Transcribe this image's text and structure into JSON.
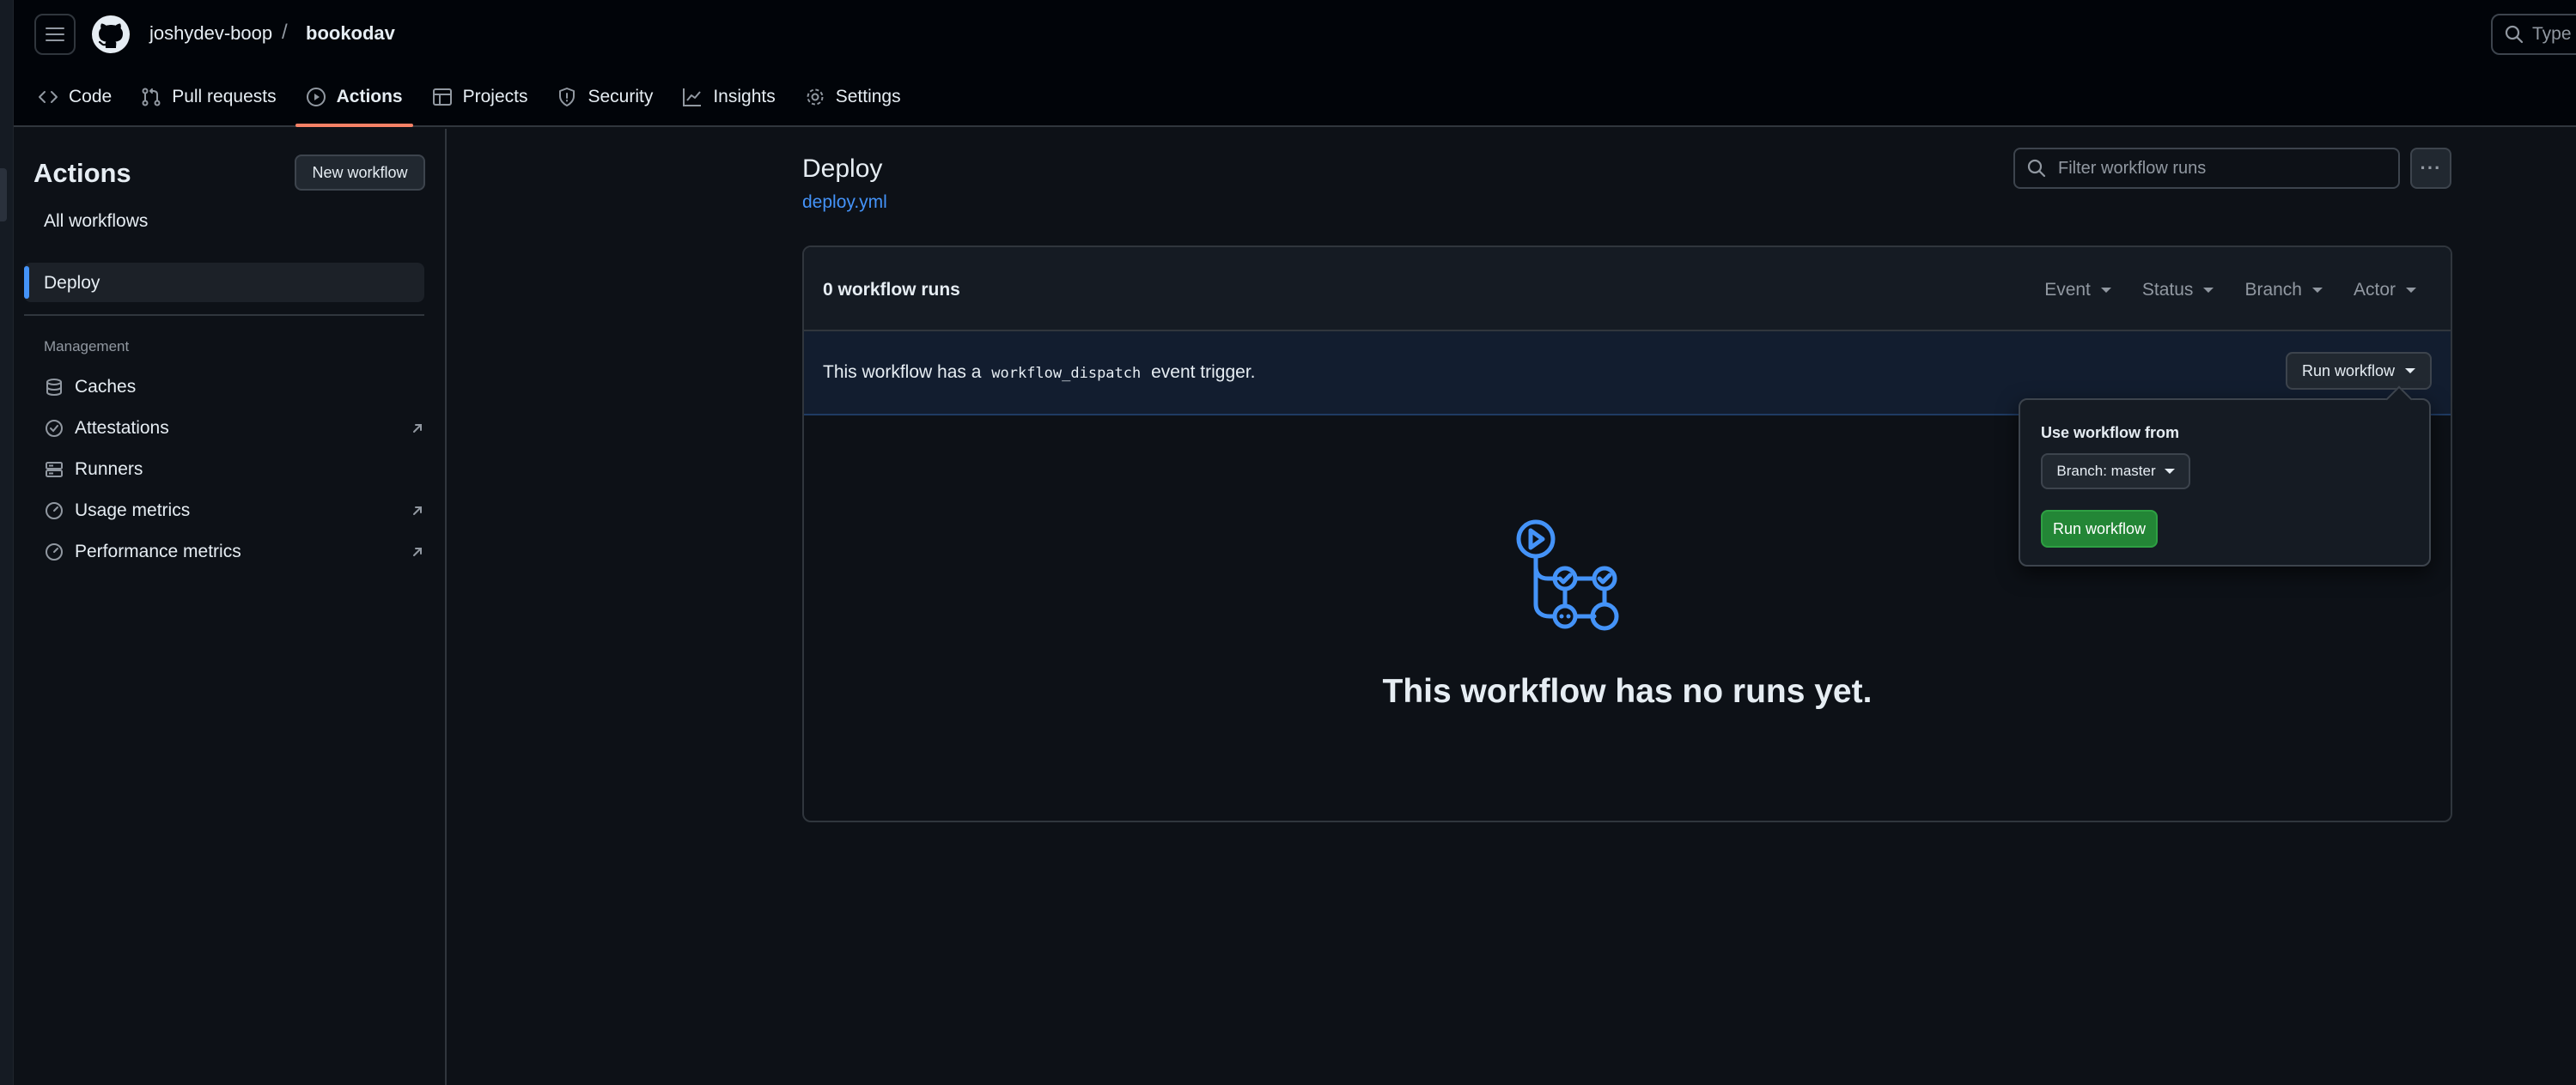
{
  "header": {
    "owner": "joshydev-boop",
    "separator": "/",
    "repo": "bookodav",
    "search_text": "Type",
    "tabs": [
      {
        "label": "Code",
        "icon": "code-icon"
      },
      {
        "label": "Pull requests",
        "icon": "pull-request-icon"
      },
      {
        "label": "Actions",
        "icon": "play-icon",
        "active": true
      },
      {
        "label": "Projects",
        "icon": "table-icon"
      },
      {
        "label": "Security",
        "icon": "shield-icon"
      },
      {
        "label": "Insights",
        "icon": "graph-icon"
      },
      {
        "label": "Settings",
        "icon": "gear-icon"
      }
    ]
  },
  "sidebar": {
    "title": "Actions",
    "new_workflow_label": "New workflow",
    "all_workflows_label": "All workflows",
    "active_workflow": "Deploy",
    "management_heading": "Management",
    "management_items": [
      {
        "label": "Caches",
        "icon": "database-icon",
        "external": false
      },
      {
        "label": "Attestations",
        "icon": "verified-icon",
        "external": true
      },
      {
        "label": "Runners",
        "icon": "server-icon",
        "external": false
      },
      {
        "label": "Usage metrics",
        "icon": "meter-icon",
        "external": true
      },
      {
        "label": "Performance metrics",
        "icon": "meter-icon",
        "external": true
      }
    ]
  },
  "main": {
    "title": "Deploy",
    "file_link": "deploy.yml",
    "filter_placeholder": "Filter workflow runs",
    "kebab_label": "···",
    "runs_count": "0 workflow runs",
    "filters": [
      "Event",
      "Status",
      "Branch",
      "Actor"
    ],
    "dispatch_prefix": "This workflow has a",
    "dispatch_code": "workflow_dispatch",
    "dispatch_suffix": "event trigger.",
    "run_workflow_label": "Run workflow",
    "empty_message": "This workflow has no runs yet."
  },
  "popover": {
    "label": "Use workflow from",
    "branch_label": "Branch: master",
    "run_label": "Run workflow"
  },
  "colors": {
    "accent": "#4493f8",
    "active_tab_underline": "#f78166",
    "primary_button": "#238636",
    "background": "#0d1117"
  }
}
